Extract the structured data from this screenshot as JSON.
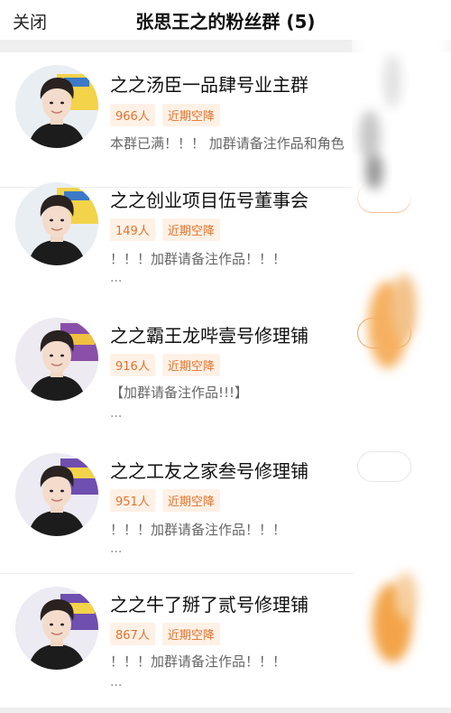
{
  "header": {
    "close_label": "关闭",
    "title": "张思王之的粉丝群 (5)"
  },
  "groups": [
    {
      "name": "之之汤臣一品肆号业主群",
      "members": "966人",
      "status": "近期空降",
      "desc": "本群已满！！！ 加群请备注作品和角色",
      "more": ""
    },
    {
      "name": "之之创业项目伍号董事会",
      "members": "149人",
      "status": "近期空降",
      "desc": "！！！加群请备注作品！！！",
      "more": "..."
    },
    {
      "name": "之之霸王龙哔壹号修理铺",
      "members": "916人",
      "status": "近期空降",
      "desc": "【加群请备注作品!!!】",
      "more": "..."
    },
    {
      "name": "之之工友之家叁号修理铺",
      "members": "951人",
      "status": "近期空降",
      "desc": "！！！加群请备注作品！！！",
      "more": "..."
    },
    {
      "name": "之之牛了掰了贰号修理铺",
      "members": "867人",
      "status": "近期空降",
      "desc": "！！！加群请备注作品！！！",
      "more": "..."
    }
  ],
  "colors": {
    "accent": "#e2722c",
    "tag_bg": "#fff1e6",
    "join_border": "#f5a06a"
  }
}
